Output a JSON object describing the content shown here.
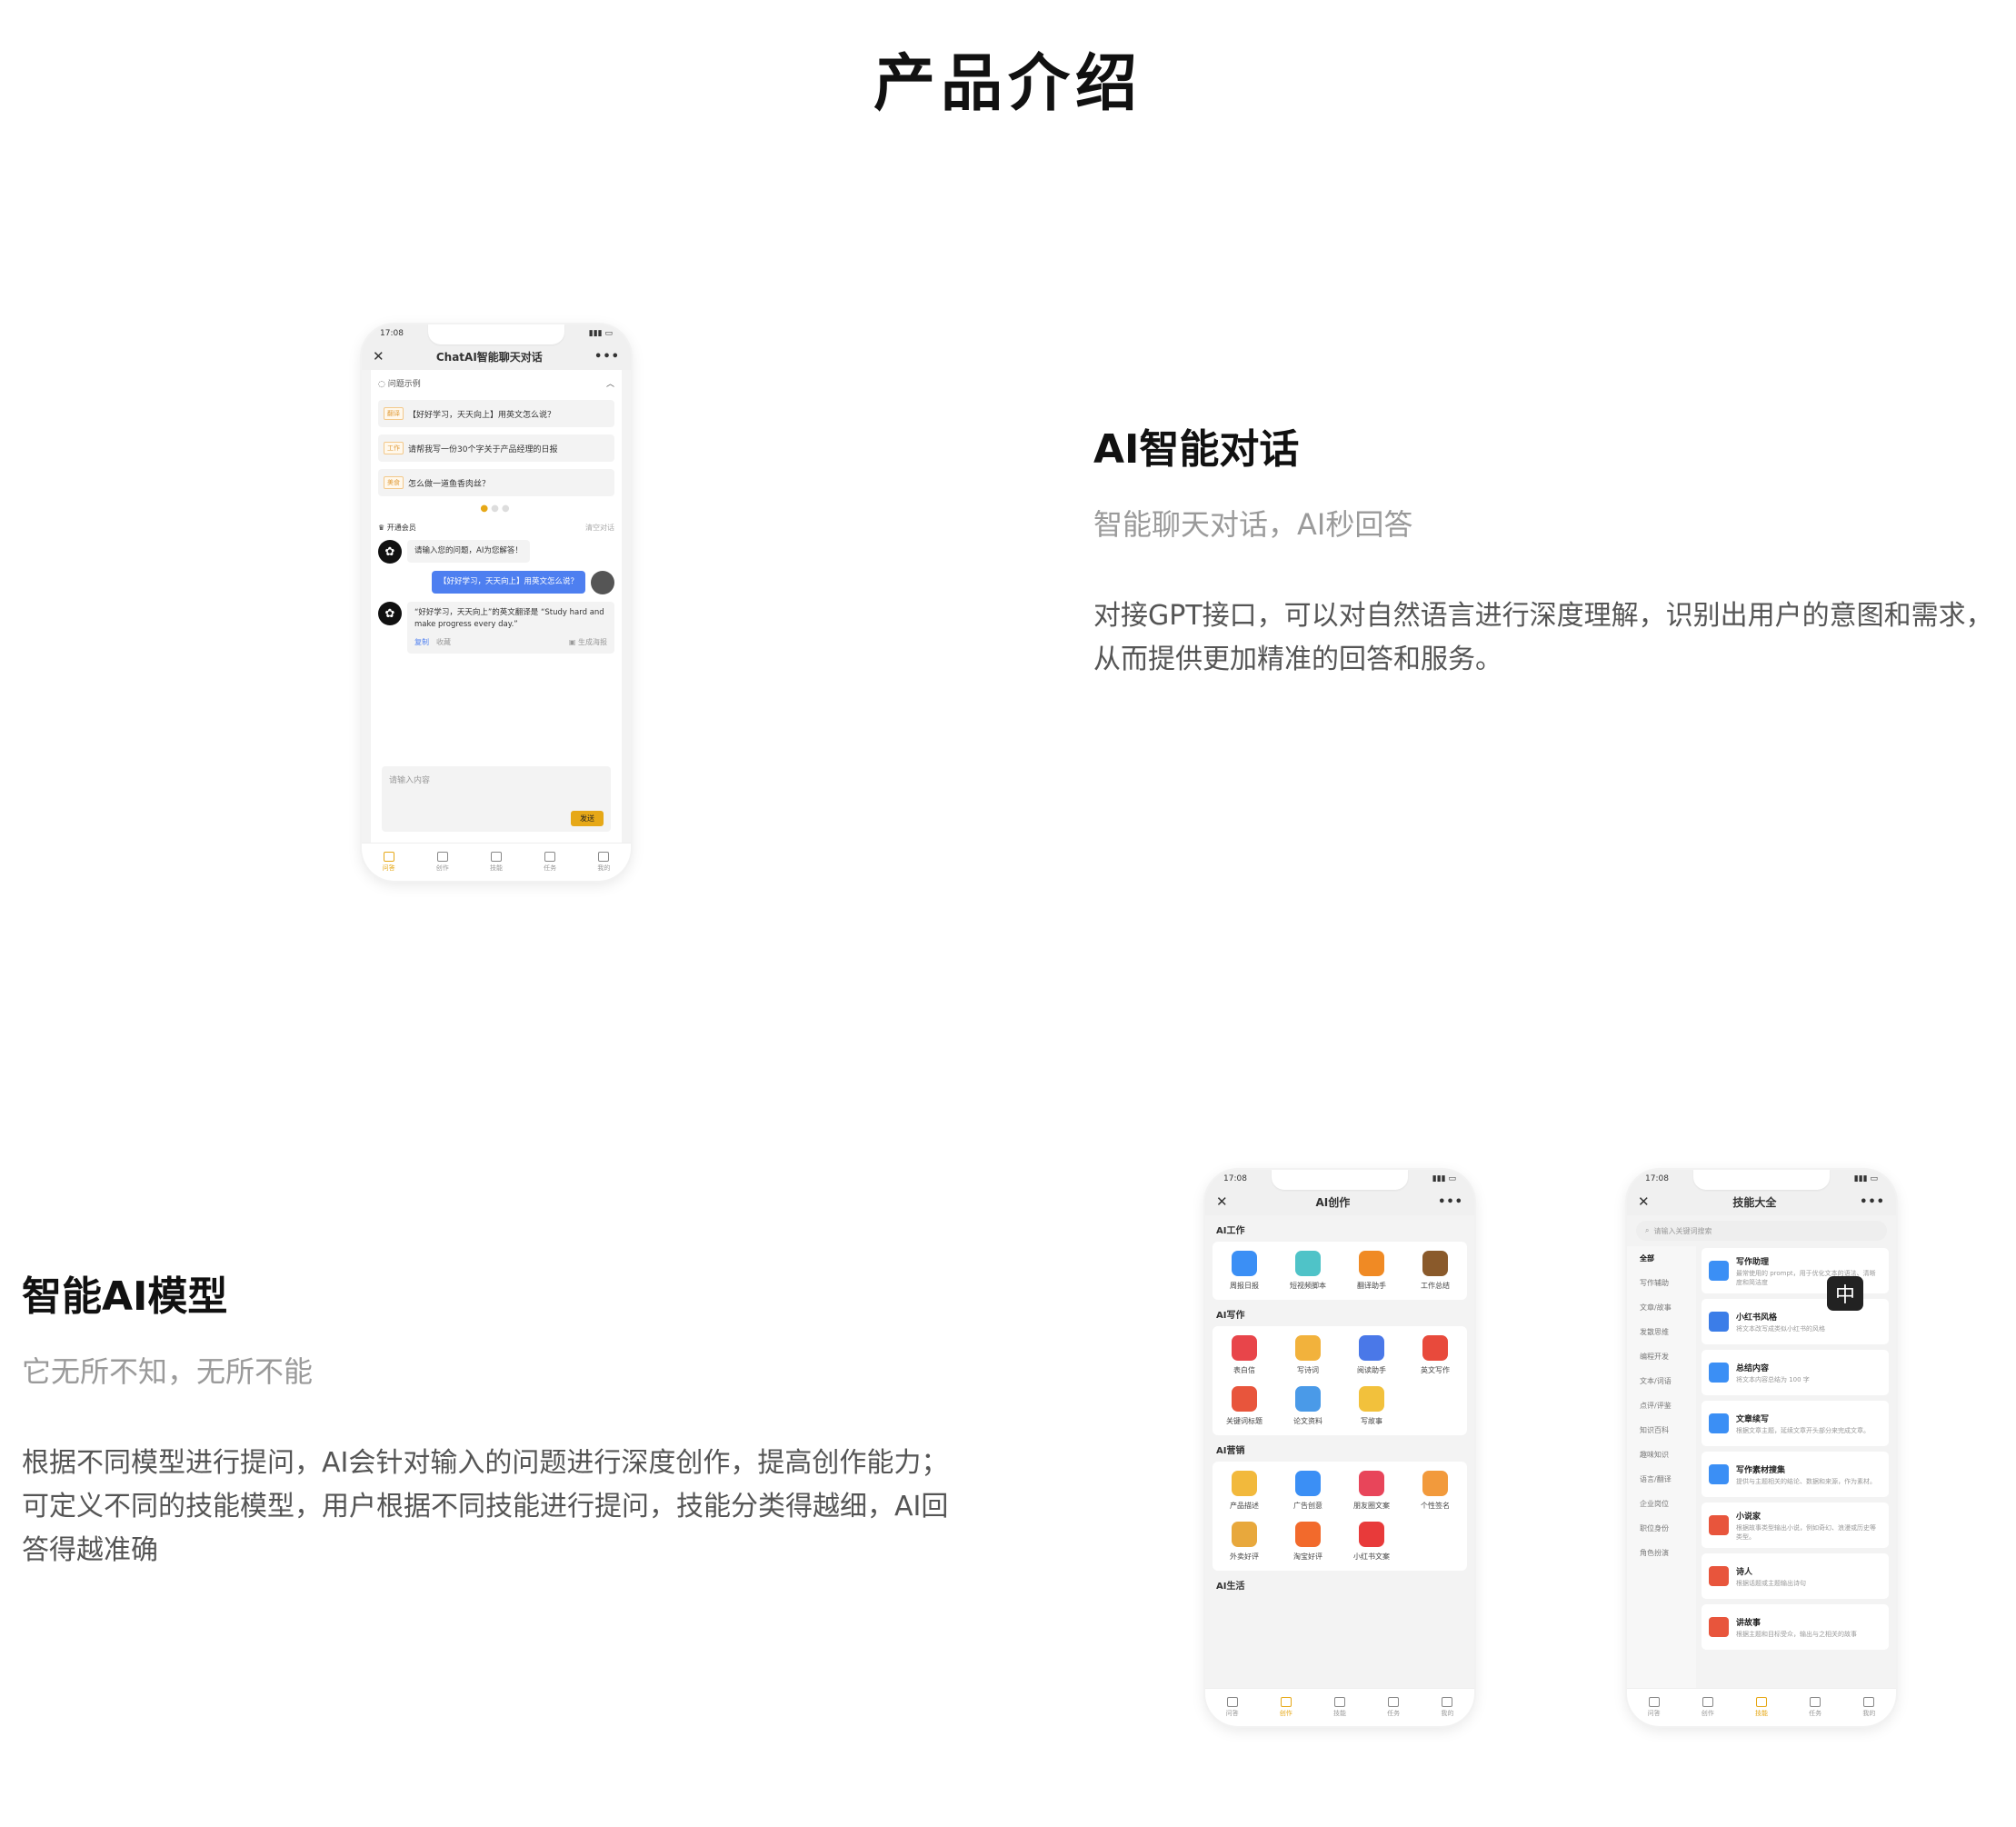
{
  "page_title": "产品介绍",
  "feature1": {
    "title": "AI智能对话",
    "subtitle": "智能聊天对话，AI秒回答",
    "description": "对接GPT接口，可以对自然语言进行深度理解，识别出用户的意图和需求，从而提供更加精准的回答和服务。"
  },
  "feature2": {
    "title": "智能AI模型",
    "subtitle": "它无所不知，无所不能",
    "description": "根据不同模型进行提问，AI会针对输入的问题进行深度创作，提高创作能力；可定义不同的技能模型，用户根据不同技能进行提问，技能分类得越细，AI回答得越准确"
  },
  "phone_chat": {
    "time": "17:08",
    "title": "ChatAI智能聊天对话",
    "examples_header": "问题示例",
    "examples": [
      {
        "tag": "翻译",
        "text": "【好好学习，天天向上】用英文怎么说？"
      },
      {
        "tag": "工作",
        "text": "请帮我写一份30个字关于产品经理的日报"
      },
      {
        "tag": "美食",
        "text": "怎么做一道鱼香肉丝？"
      }
    ],
    "vip_label": "开通会员",
    "clear_label": "清空对话",
    "bot_greeting": "请输入您的问题，AI为您解答！",
    "user_message": "【好好学习，天天向上】用英文怎么说？",
    "bot_answer": "“好好学习，天天向上”的英文翻译是 “Study hard and make progress every day.”",
    "copy_label": "复制",
    "fav_label": "收藏",
    "poster_label": "生成海报",
    "input_placeholder": "请输入内容",
    "send_label": "发送",
    "tabs": [
      "问答",
      "创作",
      "技能",
      "任务",
      "我的"
    ]
  },
  "phone_create": {
    "time": "17:08",
    "title": "AI创作",
    "groups": [
      {
        "name": "AI工作",
        "items": [
          {
            "label": "周报日报",
            "icon": "calendar-icon",
            "color": "#3b8ff5"
          },
          {
            "label": "短视频脚本",
            "icon": "clapper-icon",
            "color": "#4fc3c8"
          },
          {
            "label": "翻译助手",
            "icon": "translate-icon",
            "color": "#f08a24"
          },
          {
            "label": "工作总结",
            "icon": "briefcase-icon",
            "color": "#8a5a2b"
          }
        ]
      },
      {
        "name": "AI写作",
        "items": [
          {
            "label": "表白信",
            "icon": "letter-icon",
            "color": "#e8454a"
          },
          {
            "label": "写诗词",
            "icon": "book-icon",
            "color": "#f2b23c"
          },
          {
            "label": "阅读助手",
            "icon": "books-icon",
            "color": "#4a78e8"
          },
          {
            "label": "英文写作",
            "icon": "english-icon",
            "color": "#e84a3c"
          },
          {
            "label": "关键词标题",
            "icon": "target-icon",
            "color": "#e8553c"
          },
          {
            "label": "论文资料",
            "icon": "folders-icon",
            "color": "#4a9ae8"
          },
          {
            "label": "写故事",
            "icon": "pencil-note-icon",
            "color": "#f2c13c"
          }
        ]
      },
      {
        "name": "AI营销",
        "items": [
          {
            "label": "产品描述",
            "icon": "bag-icon",
            "color": "#f2b93c"
          },
          {
            "label": "广告创意",
            "icon": "gear-bulb-icon",
            "color": "#3b8ff5"
          },
          {
            "label": "朋友圈文案",
            "icon": "aperture-icon",
            "color": "#e8455a"
          },
          {
            "label": "个性签名",
            "icon": "pen-icon",
            "color": "#f29a3c"
          },
          {
            "label": "外卖好评",
            "icon": "thumb-icon",
            "color": "#e8a83c"
          },
          {
            "label": "淘宝好评",
            "icon": "taobao-icon",
            "color": "#f26a2c"
          },
          {
            "label": "小红书文案",
            "icon": "xiaohongshu-icon",
            "color": "#e83a3a"
          }
        ]
      }
    ],
    "more_group": "AI生活",
    "tabs": [
      "问答",
      "创作",
      "技能",
      "任务",
      "我的"
    ]
  },
  "phone_skills": {
    "time": "17:08",
    "title": "技能大全",
    "search_placeholder": "请输入关键词搜索",
    "categories": [
      "全部",
      "写作辅助",
      "文章/故事",
      "发散思维",
      "编程开发",
      "文本/词语",
      "点评/评鉴",
      "知识百科",
      "趣味知识",
      "语言/翻译",
      "企业岗位",
      "职位身份",
      "角色扮演"
    ],
    "skills": [
      {
        "title": "写作助理",
        "desc": "最常使用的 prompt，用于优化文本的语法、清晰度和简洁度",
        "icon": "quill-icon",
        "color": "#3b8ff5"
      },
      {
        "title": "小红书风格",
        "desc": "将文本改写成类似小红书的风格",
        "icon": "book-icon",
        "color": "#3b7de8"
      },
      {
        "title": "总结内容",
        "desc": "将文本内容总结为 100 字",
        "icon": "chat-icon",
        "color": "#3b8ff5"
      },
      {
        "title": "文章续写",
        "desc": "根据文章主题，延续文章开头部分来完成文章。",
        "icon": "edit-icon",
        "color": "#3b8ff5"
      },
      {
        "title": "写作素材搜集",
        "desc": "提供与主题相关的结论、数据和来源，作为素材。",
        "icon": "doc-search-icon",
        "color": "#3b8ff5"
      },
      {
        "title": "小说家",
        "desc": "根据故事类型输出小说，例如奇幻、浪漫或历史等类型。",
        "icon": "writer-icon",
        "color": "#e8553c"
      },
      {
        "title": "诗人",
        "desc": "根据话题或主题输出诗句",
        "icon": "poet-icon",
        "color": "#e8553c"
      },
      {
        "title": "讲故事",
        "desc": "根据主题和目标受众，输出与之相关的故事",
        "icon": "storyteller-icon",
        "color": "#e8553c"
      }
    ],
    "ime_label": "中",
    "tabs": [
      "问答",
      "创作",
      "技能",
      "任务",
      "我的"
    ]
  }
}
